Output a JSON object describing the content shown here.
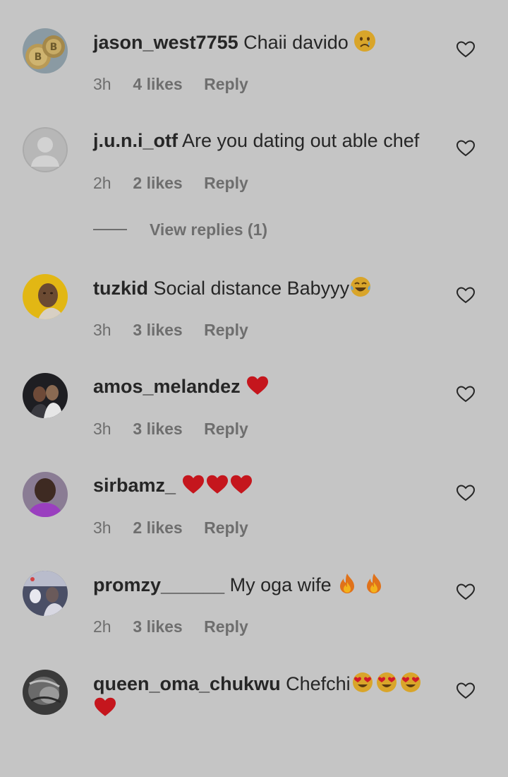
{
  "comments": [
    {
      "username": "jason_west7755",
      "text": "Chaii davido",
      "emoji": [
        "crying-face"
      ],
      "time": "3h",
      "likes": "4 likes",
      "reply": "Reply",
      "avatar": "bitcoin-coins"
    },
    {
      "username": "j.u.n.i_otf",
      "text": "Are you dating out able chef",
      "emoji": [],
      "time": "2h",
      "likes": "2 likes",
      "reply": "Reply",
      "avatar": "default-profile"
    },
    {
      "username": "tuzkid",
      "text": "Social distance Babyyy",
      "emoji": [
        "laughing-tears"
      ],
      "time": "3h",
      "likes": "3 likes",
      "reply": "Reply",
      "avatar": "selfie-yellow"
    },
    {
      "username": "amos_melandez",
      "text": "",
      "emoji": [
        "red-heart"
      ],
      "time": "3h",
      "likes": "3 likes",
      "reply": "Reply",
      "avatar": "couple-photo"
    },
    {
      "username": "sirbamz_",
      "text": "",
      "emoji": [
        "red-heart",
        "red-heart",
        "red-heart"
      ],
      "time": "3h",
      "likes": "2 likes",
      "reply": "Reply",
      "avatar": "man-purple"
    },
    {
      "username": "promzy______",
      "text": "My oga wife",
      "emoji": [
        "fire",
        "fire"
      ],
      "time": "2h",
      "likes": "3 likes",
      "reply": "Reply",
      "avatar": "group-photo"
    },
    {
      "username": "queen_oma_chukwu",
      "text": "Chefchi",
      "emoji": [
        "heart-eyes",
        "heart-eyes",
        "heart-eyes",
        "red-heart"
      ],
      "time": "",
      "likes": "",
      "reply": "",
      "avatar": "monochrome-photo"
    }
  ],
  "view_replies": {
    "label": "View replies (1)"
  },
  "icons": {
    "like": "heart-outline-icon"
  },
  "colors": {
    "background": "#c5c5c5",
    "text": "#262626",
    "meta": "#6e6e6e",
    "heart": "#c5161d"
  }
}
